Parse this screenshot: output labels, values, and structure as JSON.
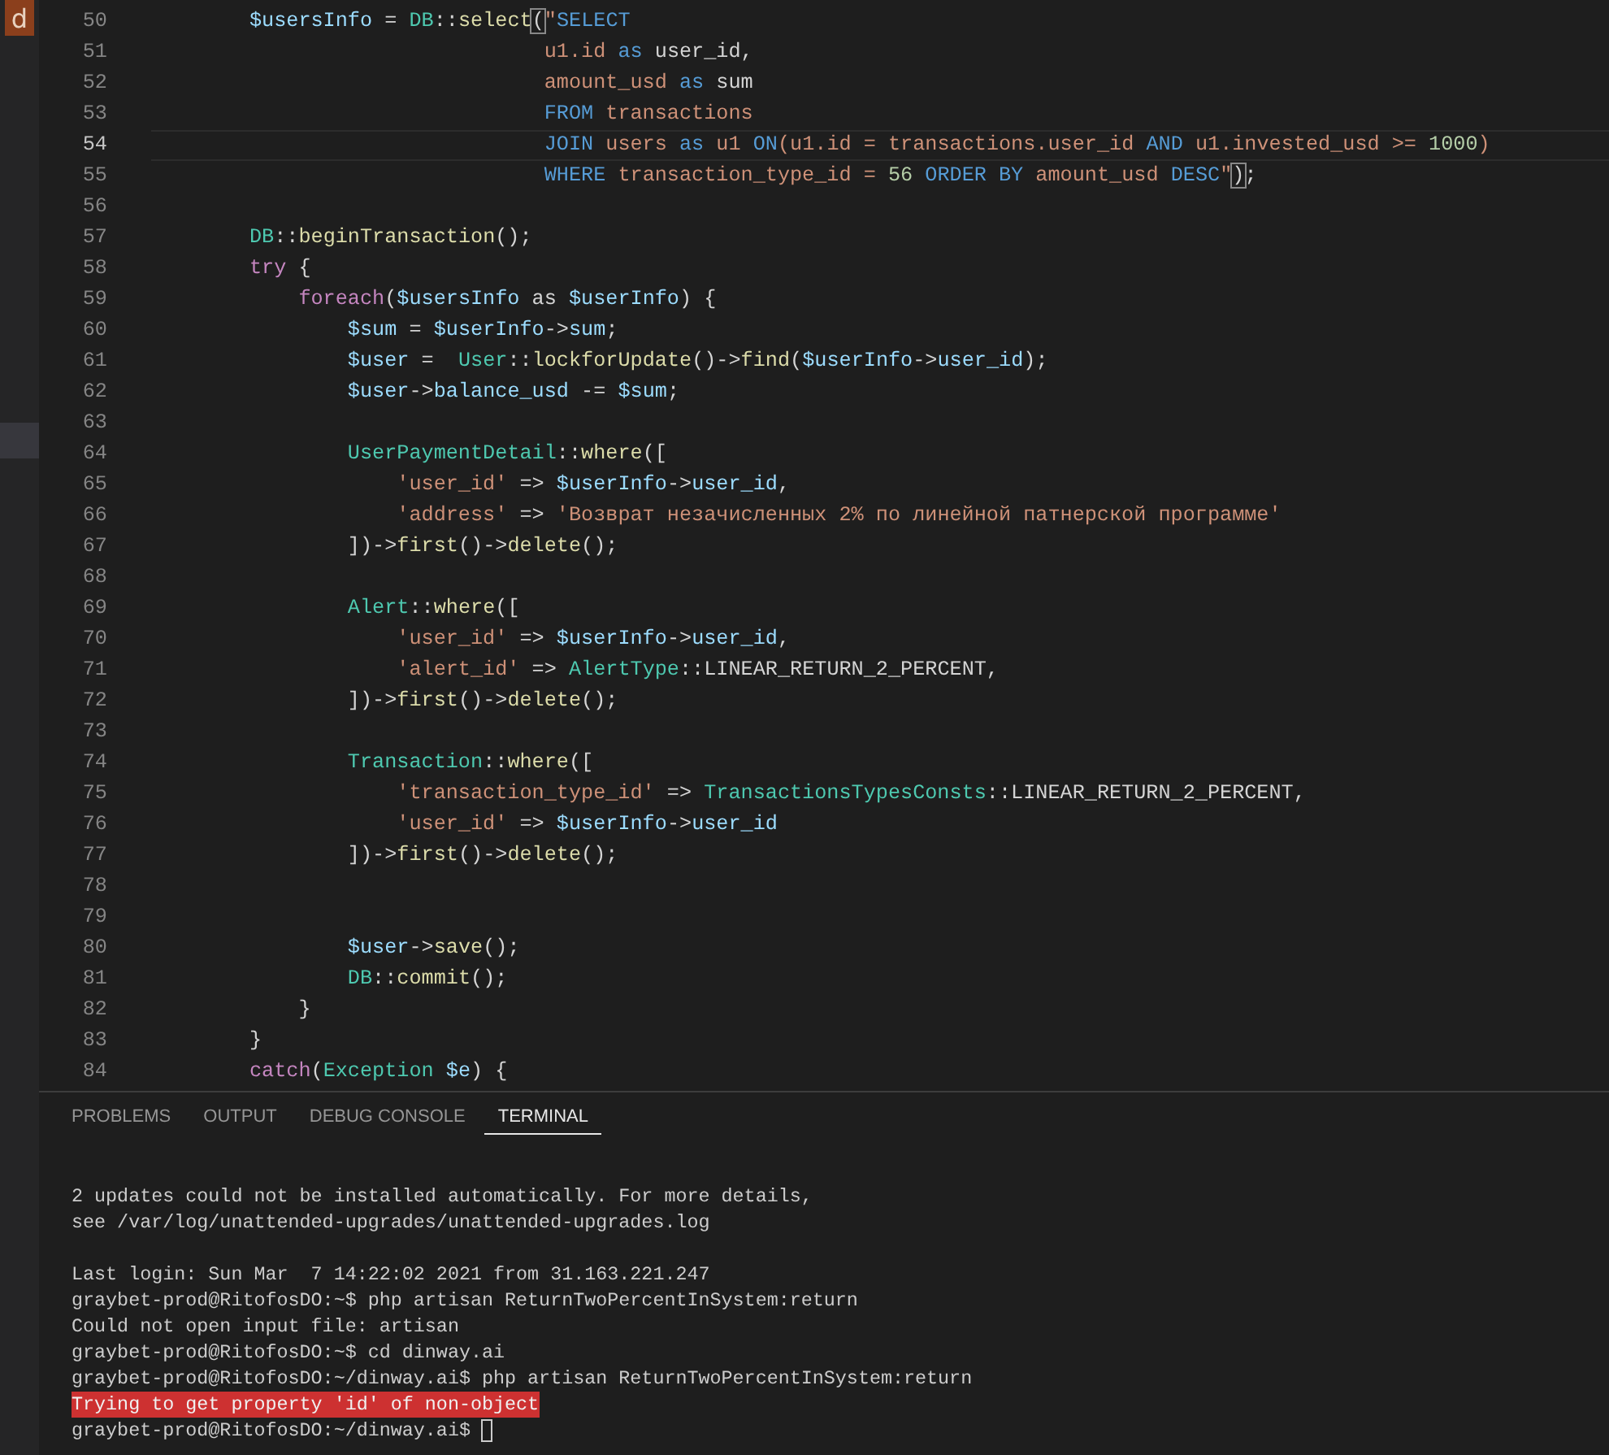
{
  "activity_bar": {
    "badge": "d"
  },
  "editor": {
    "lines": [
      {
        "number": "50",
        "current": false,
        "tokens": [
          {
            "kind": "var",
            "text": "        $usersInfo"
          },
          {
            "kind": "plain",
            "text": " = "
          },
          {
            "kind": "class",
            "text": "DB"
          },
          {
            "kind": "plain",
            "text": "::"
          },
          {
            "kind": "fn",
            "text": "select"
          },
          {
            "kind": "match",
            "text": "("
          },
          {
            "kind": "str",
            "text": "\""
          },
          {
            "kind": "kw",
            "text": "SELECT"
          }
        ]
      },
      {
        "number": "51",
        "current": false,
        "tokens": [
          {
            "kind": "str",
            "text": "                                u1.id"
          },
          {
            "kind": "kw",
            "text": " as"
          },
          {
            "kind": "plain",
            "text": " user_id,"
          }
        ]
      },
      {
        "number": "52",
        "current": false,
        "tokens": [
          {
            "kind": "str",
            "text": "                                amount_usd"
          },
          {
            "kind": "kw",
            "text": " as"
          },
          {
            "kind": "plain",
            "text": " sum"
          }
        ]
      },
      {
        "number": "53",
        "current": false,
        "tokens": [
          {
            "kind": "kw",
            "text": "                                FROM"
          },
          {
            "kind": "str",
            "text": " transactions"
          }
        ]
      },
      {
        "number": "54",
        "current": true,
        "tokens": [
          {
            "kind": "kw",
            "text": "                                JOIN"
          },
          {
            "kind": "str",
            "text": " users "
          },
          {
            "kind": "kw",
            "text": "as"
          },
          {
            "kind": "str",
            "text": " u1 "
          },
          {
            "kind": "kw",
            "text": "ON"
          },
          {
            "kind": "str",
            "text": "(u1.id = transactions.user_id "
          },
          {
            "kind": "kw",
            "text": "AND"
          },
          {
            "kind": "str",
            "text": " u1.invested_usd >= "
          },
          {
            "kind": "num",
            "text": "1000"
          },
          {
            "kind": "str",
            "text": ")"
          }
        ]
      },
      {
        "number": "55",
        "current": false,
        "tokens": [
          {
            "kind": "kw",
            "text": "                                WHERE"
          },
          {
            "kind": "str",
            "text": " transaction_type_id = "
          },
          {
            "kind": "num",
            "text": "56"
          },
          {
            "kind": "kw",
            "text": " ORDER BY"
          },
          {
            "kind": "str",
            "text": " amount_usd "
          },
          {
            "kind": "kw",
            "text": "DESC"
          },
          {
            "kind": "str",
            "text": "\""
          },
          {
            "kind": "match",
            "text": ")"
          },
          {
            "kind": "plain",
            "text": ";"
          }
        ]
      },
      {
        "number": "56",
        "current": false
      },
      {
        "number": "57",
        "current": false,
        "tokens": [
          {
            "kind": "class",
            "text": "        DB"
          },
          {
            "kind": "plain",
            "text": "::"
          },
          {
            "kind": "fn",
            "text": "beginTransaction"
          },
          {
            "kind": "plain",
            "text": "();"
          }
        ]
      },
      {
        "number": "58",
        "current": false,
        "tokens": [
          {
            "kind": "ctrl",
            "text": "        try"
          },
          {
            "kind": "plain",
            "text": " {"
          }
        ]
      },
      {
        "number": "59",
        "current": false,
        "tokens": [
          {
            "kind": "ctrl",
            "text": "            foreach"
          },
          {
            "kind": "plain",
            "text": "("
          },
          {
            "kind": "var",
            "text": "$usersInfo"
          },
          {
            "kind": "plain",
            "text": " as "
          },
          {
            "kind": "var",
            "text": "$userInfo"
          },
          {
            "kind": "plain",
            "text": ") {"
          }
        ]
      },
      {
        "number": "60",
        "current": false,
        "tokens": [
          {
            "kind": "var",
            "text": "                $sum"
          },
          {
            "kind": "plain",
            "text": " = "
          },
          {
            "kind": "var",
            "text": "$userInfo"
          },
          {
            "kind": "plain",
            "text": "->"
          },
          {
            "kind": "var",
            "text": "sum"
          },
          {
            "kind": "plain",
            "text": ";"
          }
        ]
      },
      {
        "number": "61",
        "current": false,
        "tokens": [
          {
            "kind": "var",
            "text": "                $user"
          },
          {
            "kind": "plain",
            "text": " =  "
          },
          {
            "kind": "class",
            "text": "User"
          },
          {
            "kind": "plain",
            "text": "::"
          },
          {
            "kind": "fn",
            "text": "lockforUpdate"
          },
          {
            "kind": "plain",
            "text": "()->"
          },
          {
            "kind": "fn",
            "text": "find"
          },
          {
            "kind": "plain",
            "text": "("
          },
          {
            "kind": "var",
            "text": "$userInfo"
          },
          {
            "kind": "plain",
            "text": "->"
          },
          {
            "kind": "var",
            "text": "user_id"
          },
          {
            "kind": "plain",
            "text": ");"
          }
        ]
      },
      {
        "number": "62",
        "current": false,
        "tokens": [
          {
            "kind": "var",
            "text": "                $user"
          },
          {
            "kind": "plain",
            "text": "->"
          },
          {
            "kind": "var",
            "text": "balance_usd"
          },
          {
            "kind": "plain",
            "text": " -= "
          },
          {
            "kind": "var",
            "text": "$sum"
          },
          {
            "kind": "plain",
            "text": ";"
          }
        ]
      },
      {
        "number": "63",
        "current": false
      },
      {
        "number": "64",
        "current": false,
        "tokens": [
          {
            "kind": "class",
            "text": "                UserPaymentDetail"
          },
          {
            "kind": "plain",
            "text": "::"
          },
          {
            "kind": "fn",
            "text": "where"
          },
          {
            "kind": "plain",
            "text": "(["
          }
        ]
      },
      {
        "number": "65",
        "current": false,
        "tokens": [
          {
            "kind": "str",
            "text": "                    'user_id'"
          },
          {
            "kind": "plain",
            "text": " => "
          },
          {
            "kind": "var",
            "text": "$userInfo"
          },
          {
            "kind": "plain",
            "text": "->"
          },
          {
            "kind": "var",
            "text": "user_id"
          },
          {
            "kind": "plain",
            "text": ","
          }
        ]
      },
      {
        "number": "66",
        "current": false,
        "tokens": [
          {
            "kind": "str",
            "text": "                    'address'"
          },
          {
            "kind": "plain",
            "text": " => "
          },
          {
            "kind": "str",
            "text": "'Возврат незачисленных 2% по линейной патнерской программе'"
          }
        ]
      },
      {
        "number": "67",
        "current": false,
        "tokens": [
          {
            "kind": "plain",
            "text": "                ])->"
          },
          {
            "kind": "fn",
            "text": "first"
          },
          {
            "kind": "plain",
            "text": "()->"
          },
          {
            "kind": "fn",
            "text": "delete"
          },
          {
            "kind": "plain",
            "text": "();"
          }
        ]
      },
      {
        "number": "68",
        "current": false
      },
      {
        "number": "69",
        "current": false,
        "tokens": [
          {
            "kind": "class",
            "text": "                Alert"
          },
          {
            "kind": "plain",
            "text": "::"
          },
          {
            "kind": "fn",
            "text": "where"
          },
          {
            "kind": "plain",
            "text": "(["
          }
        ]
      },
      {
        "number": "70",
        "current": false,
        "tokens": [
          {
            "kind": "str",
            "text": "                    'user_id'"
          },
          {
            "kind": "plain",
            "text": " => "
          },
          {
            "kind": "var",
            "text": "$userInfo"
          },
          {
            "kind": "plain",
            "text": "->"
          },
          {
            "kind": "var",
            "text": "user_id"
          },
          {
            "kind": "plain",
            "text": ","
          }
        ]
      },
      {
        "number": "71",
        "current": false,
        "tokens": [
          {
            "kind": "str",
            "text": "                    'alert_id'"
          },
          {
            "kind": "plain",
            "text": " => "
          },
          {
            "kind": "class",
            "text": "AlertType"
          },
          {
            "kind": "plain",
            "text": "::LINEAR_RETURN_2_PERCENT,"
          }
        ]
      },
      {
        "number": "72",
        "current": false,
        "tokens": [
          {
            "kind": "plain",
            "text": "                ])->"
          },
          {
            "kind": "fn",
            "text": "first"
          },
          {
            "kind": "plain",
            "text": "()->"
          },
          {
            "kind": "fn",
            "text": "delete"
          },
          {
            "kind": "plain",
            "text": "();"
          }
        ]
      },
      {
        "number": "73",
        "current": false
      },
      {
        "number": "74",
        "current": false,
        "tokens": [
          {
            "kind": "class",
            "text": "                Transaction"
          },
          {
            "kind": "plain",
            "text": "::"
          },
          {
            "kind": "fn",
            "text": "where"
          },
          {
            "kind": "plain",
            "text": "(["
          }
        ]
      },
      {
        "number": "75",
        "current": false,
        "tokens": [
          {
            "kind": "str",
            "text": "                    'transaction_type_id'"
          },
          {
            "kind": "plain",
            "text": " => "
          },
          {
            "kind": "class",
            "text": "TransactionsTypesConsts"
          },
          {
            "kind": "plain",
            "text": "::LINEAR_RETURN_2_PERCENT,"
          }
        ]
      },
      {
        "number": "76",
        "current": false,
        "tokens": [
          {
            "kind": "str",
            "text": "                    'user_id'"
          },
          {
            "kind": "plain",
            "text": " => "
          },
          {
            "kind": "var",
            "text": "$userInfo"
          },
          {
            "kind": "plain",
            "text": "->"
          },
          {
            "kind": "var",
            "text": "user_id"
          }
        ]
      },
      {
        "number": "77",
        "current": false,
        "tokens": [
          {
            "kind": "plain",
            "text": "                ])->"
          },
          {
            "kind": "fn",
            "text": "first"
          },
          {
            "kind": "plain",
            "text": "()->"
          },
          {
            "kind": "fn",
            "text": "delete"
          },
          {
            "kind": "plain",
            "text": "();"
          }
        ]
      },
      {
        "number": "78",
        "current": false
      },
      {
        "number": "79",
        "current": false
      },
      {
        "number": "80",
        "current": false,
        "tokens": [
          {
            "kind": "var",
            "text": "                $user"
          },
          {
            "kind": "plain",
            "text": "->"
          },
          {
            "kind": "fn",
            "text": "save"
          },
          {
            "kind": "plain",
            "text": "();"
          }
        ]
      },
      {
        "number": "81",
        "current": false,
        "tokens": [
          {
            "kind": "class",
            "text": "                DB"
          },
          {
            "kind": "plain",
            "text": "::"
          },
          {
            "kind": "fn",
            "text": "commit"
          },
          {
            "kind": "plain",
            "text": "();"
          }
        ]
      },
      {
        "number": "82",
        "current": false,
        "tokens": [
          {
            "kind": "plain",
            "text": "            }"
          }
        ]
      },
      {
        "number": "83",
        "current": false,
        "tokens": [
          {
            "kind": "plain",
            "text": "        }"
          }
        ]
      },
      {
        "number": "84",
        "current": false,
        "tokens": [
          {
            "kind": "ctrl",
            "text": "        catch"
          },
          {
            "kind": "plain",
            "text": "("
          },
          {
            "kind": "class",
            "text": "Exception"
          },
          {
            "kind": "var",
            "text": " $e"
          },
          {
            "kind": "plain",
            "text": ") {"
          }
        ]
      }
    ]
  },
  "panel": {
    "tabs": [
      {
        "label": "PROBLEMS",
        "selected": false
      },
      {
        "label": "OUTPUT",
        "selected": false
      },
      {
        "label": "DEBUG CONSOLE",
        "selected": false
      },
      {
        "label": "TERMINAL",
        "selected": true
      }
    ],
    "terminal": [
      {
        "kind": "text",
        "text": "2 updates could not be installed automatically. For more details,"
      },
      {
        "kind": "text",
        "text": "see /var/log/unattended-upgrades/unattended-upgrades.log"
      },
      {
        "kind": "blank"
      },
      {
        "kind": "text",
        "text": "Last login: Sun Mar  7 14:22:02 2021 from 31.163.221.247"
      },
      {
        "kind": "text",
        "text": "graybet-prod@RitofosDO:~$ php artisan ReturnTwoPercentInSystem:return"
      },
      {
        "kind": "text",
        "text": "Could not open input file: artisan"
      },
      {
        "kind": "text",
        "text": "graybet-prod@RitofosDO:~$ cd dinway.ai"
      },
      {
        "kind": "text",
        "text": "graybet-prod@RitofosDO:~/dinway.ai$ php artisan ReturnTwoPercentInSystem:return"
      },
      {
        "kind": "error",
        "text": "Trying to get property 'id' of non-object"
      },
      {
        "kind": "prompt",
        "text": "graybet-prod@RitofosDO:~/dinway.ai$"
      }
    ]
  }
}
